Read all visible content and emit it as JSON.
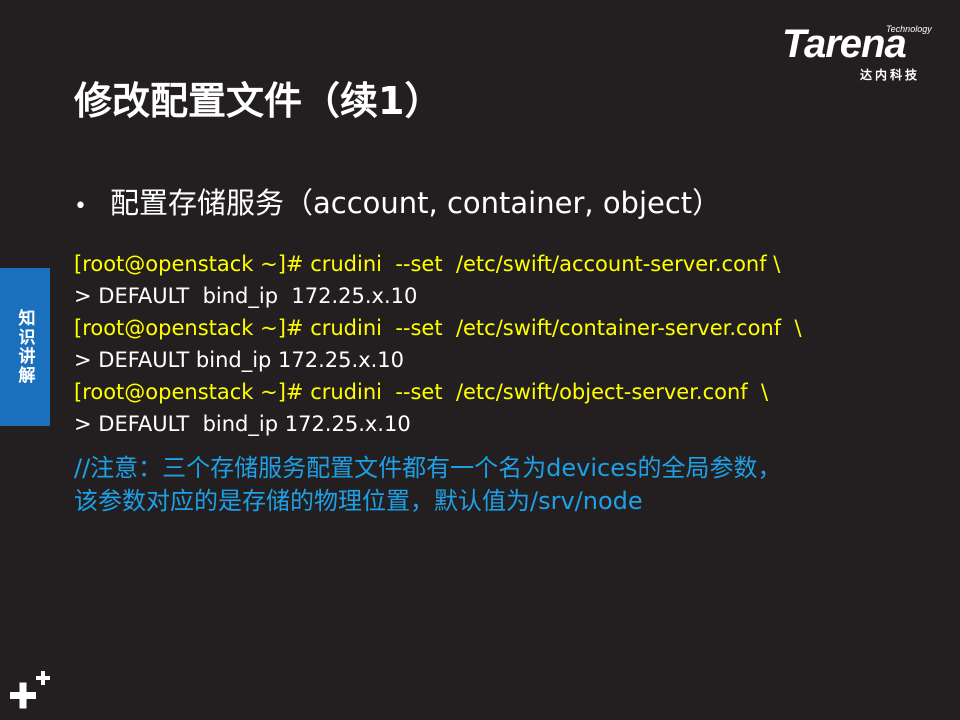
{
  "logo": {
    "technology": "Technology",
    "wordmark": "Tarena",
    "subtitle": "达内科技"
  },
  "title": "修改配置文件（续1）",
  "side_tab": {
    "label": "知识讲解"
  },
  "bullet": {
    "dot": "•",
    "text": "配置存储服务（account, container, object）"
  },
  "code_lines": [
    {
      "text": "[root@openstack ~]# crudini  --set  /etc/swift/account-server.conf \\",
      "color": "#ffff00"
    },
    {
      "text": "> DEFAULT  bind_ip  172.25.x.10",
      "color": "#ffffff"
    },
    {
      "text": "[root@openstack ~]# crudini  --set  /etc/swift/container-server.conf  \\",
      "color": "#ffff00"
    },
    {
      "text": "> DEFAULT bind_ip 172.25.x.10",
      "color": "#ffffff"
    },
    {
      "text": "[root@openstack ~]# crudini  --set  /etc/swift/object-server.conf  \\",
      "color": "#ffff00"
    },
    {
      "text": "> DEFAULT  bind_ip 172.25.x.10",
      "color": "#ffffff"
    }
  ],
  "note_lines": [
    "//注意：三个存储服务配置文件都有一个名为devices的全局参数，",
    "该参数对应的是存储的物理位置，默认值为/srv/node"
  ],
  "colors": {
    "background": "#231f20",
    "accent_blue": "#1a70bd",
    "command_yellow": "#ffff00",
    "note_blue": "#1ea0e6"
  },
  "icons": {
    "corner": "plus-plus-icon"
  }
}
